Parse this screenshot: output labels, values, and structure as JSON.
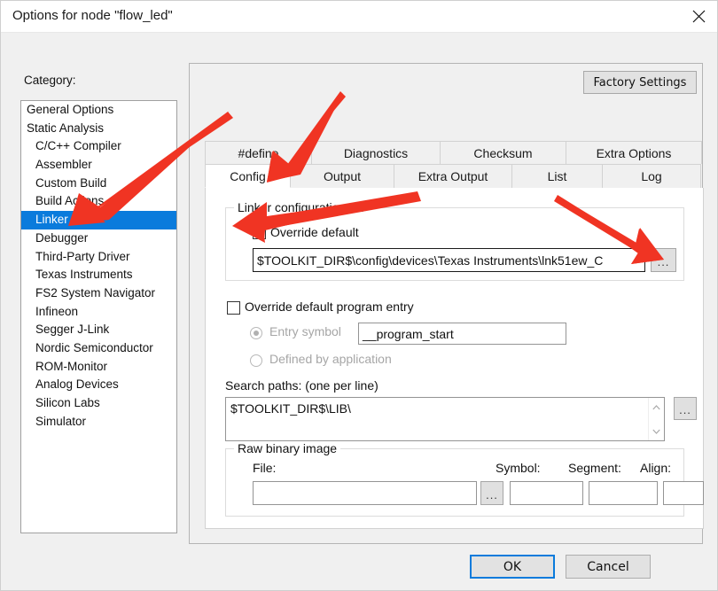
{
  "window": {
    "title": "Options for node \"flow_led\"",
    "close_icon": "close-icon"
  },
  "sidebar": {
    "label": "Category:",
    "items": [
      {
        "label": "General Options",
        "indent": false,
        "selected": false
      },
      {
        "label": "Static Analysis",
        "indent": false,
        "selected": false
      },
      {
        "label": "C/C++ Compiler",
        "indent": true,
        "selected": false
      },
      {
        "label": "Assembler",
        "indent": true,
        "selected": false
      },
      {
        "label": "Custom Build",
        "indent": true,
        "selected": false
      },
      {
        "label": "Build Actions",
        "indent": true,
        "selected": false
      },
      {
        "label": "Linker",
        "indent": true,
        "selected": true
      },
      {
        "label": "Debugger",
        "indent": true,
        "selected": false
      },
      {
        "label": "Third-Party Driver",
        "indent": true,
        "selected": false
      },
      {
        "label": "Texas Instruments",
        "indent": true,
        "selected": false
      },
      {
        "label": "FS2 System Navigator",
        "indent": true,
        "selected": false
      },
      {
        "label": "Infineon",
        "indent": true,
        "selected": false
      },
      {
        "label": "Segger J-Link",
        "indent": true,
        "selected": false
      },
      {
        "label": "Nordic Semiconductor",
        "indent": true,
        "selected": false
      },
      {
        "label": "ROM-Monitor",
        "indent": true,
        "selected": false
      },
      {
        "label": "Analog Devices",
        "indent": true,
        "selected": false
      },
      {
        "label": "Silicon Labs",
        "indent": true,
        "selected": false
      },
      {
        "label": "Simulator",
        "indent": true,
        "selected": false
      }
    ]
  },
  "panel": {
    "factory_settings_label": "Factory Settings",
    "tabs_row1": [
      {
        "label": "#define",
        "active": false
      },
      {
        "label": "Diagnostics",
        "active": false
      },
      {
        "label": "Checksum",
        "active": false
      },
      {
        "label": "Extra Options",
        "active": false
      }
    ],
    "tabs_row2": [
      {
        "label": "Config",
        "active": true
      },
      {
        "label": "Output",
        "active": false
      },
      {
        "label": "Extra Output",
        "active": false
      },
      {
        "label": "List",
        "active": false
      },
      {
        "label": "Log",
        "active": false
      }
    ]
  },
  "config": {
    "linker_group_title": "Linker configuration file",
    "override_default_label": "Override default",
    "override_default_checked": true,
    "config_file_value": "$TOOLKIT_DIR$\\config\\devices\\Texas Instruments\\lnk51ew_C",
    "config_browse_label": "...",
    "override_entry_label": "Override default program entry",
    "override_entry_checked": false,
    "entry_symbol_label": "Entry symbol",
    "entry_symbol_value": "__program_start",
    "entry_symbol_selected": true,
    "defined_by_app_label": "Defined by application",
    "defined_by_app_selected": false,
    "search_paths_label": "Search paths:  (one per line)",
    "search_paths_value": "$TOOLKIT_DIR$\\LIB\\",
    "search_browse_label": "...",
    "raw_group_title": "Raw binary image",
    "raw_file_label": "File:",
    "raw_file_value": "",
    "raw_file_browse_label": "...",
    "raw_symbol_label": "Symbol:",
    "raw_symbol_value": "",
    "raw_segment_label": "Segment:",
    "raw_segment_value": "",
    "raw_align_label": "Align:",
    "raw_align_value": ""
  },
  "footer": {
    "ok_label": "OK",
    "cancel_label": "Cancel"
  },
  "annotations": {
    "accent_color": "#f03423",
    "arrow_count": 4
  }
}
